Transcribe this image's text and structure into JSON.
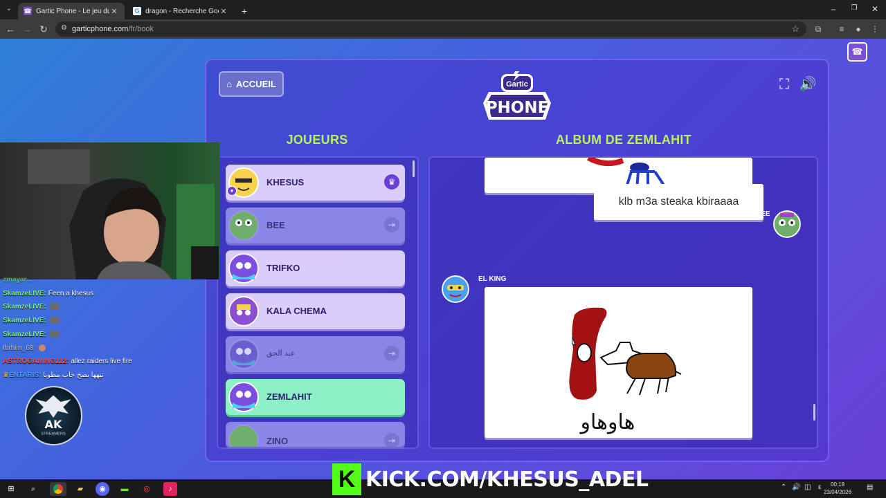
{
  "browser": {
    "tabs": [
      {
        "title": "Gartic Phone - Le jeu du téléph",
        "active": true
      },
      {
        "title": "dragon - Recherche Google",
        "active": false
      }
    ],
    "url_host": "garticphone.com",
    "url_path": "/fr/book",
    "new_tab_label": "+"
  },
  "game": {
    "home_label": "ACCUEIL",
    "logo_top": "Gartic",
    "logo_main": "PHONE",
    "players_heading": "JOUEURS",
    "album_heading": "ALBUM DE ZEMLAHIT",
    "players": [
      {
        "name": "KHESUS",
        "state": "host"
      },
      {
        "name": "BEE",
        "state": "left"
      },
      {
        "name": "TRIFKO",
        "state": "active"
      },
      {
        "name": "KALA CHEMA",
        "state": "active"
      },
      {
        "name": "عبد الحق",
        "state": "left"
      },
      {
        "name": "ZEMLAHIT",
        "state": "current"
      },
      {
        "name": "ZINO",
        "state": "left"
      }
    ],
    "album": {
      "bee_name": "BEE",
      "bee_text": "klb m3a steaka kbiraaaa",
      "elking_name": "EL KING",
      "drawing_caption": "هاوهاو"
    },
    "colors": {
      "accent_green": "#b9f25a",
      "current_player": "#8ef0c6"
    }
  },
  "chat": [
    {
      "user": "SkamzeLIVE:",
      "msg": "Feen a khesus",
      "color": "#7cf07c"
    },
    {
      "user": "SkamzeLIVE:",
      "msg": "",
      "color": "#7cf07c"
    },
    {
      "user": "SkamzeLIVE:",
      "msg": "",
      "color": "#7cf07c"
    },
    {
      "user": "SkamzeLIVE:",
      "msg": "",
      "color": "#7cf07c"
    },
    {
      "user": "Ibrhim_68:",
      "msg": "",
      "color": "#c8c8c8"
    },
    {
      "user": "ASTROGAMING112:",
      "msg": "allez raiders live fire",
      "color": "#ff4a4a"
    },
    {
      "user": "ENTARIS:",
      "msg": "تيهها بصح جاب مطوبا",
      "color": "#4aa0ff"
    }
  ],
  "overlay": {
    "kick_text": "KICK.COM/KHESUS_ADEL",
    "ak_label": "AK",
    "ak_sub": "STREAMERS"
  },
  "taskbar": {
    "time": "00:18",
    "date": "23/04/2026"
  }
}
